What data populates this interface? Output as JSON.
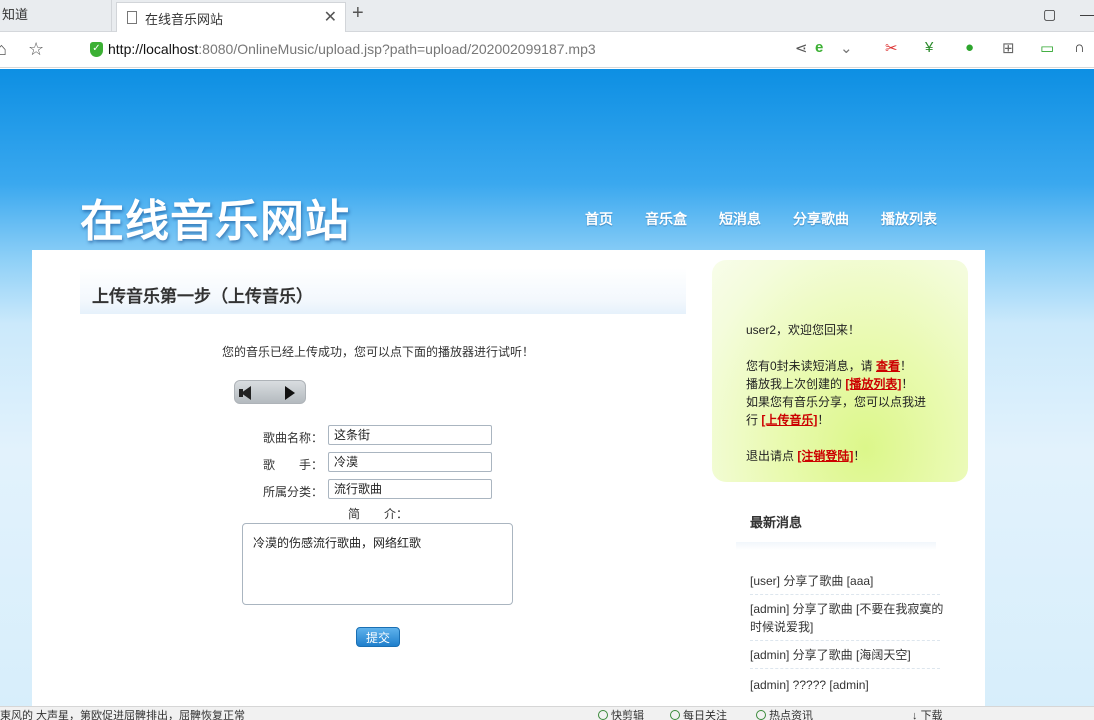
{
  "browser": {
    "left_tab_label": "知道",
    "active_tab_title": "在线音乐网站",
    "url_host": "http://localhost",
    "url_rest": ":8080/OnlineMusic/upload.jsp?path=upload/202002099187.mp3"
  },
  "site": {
    "logo": "在线音乐网站",
    "nav": [
      "首页",
      "音乐盒",
      "短消息",
      "分享歌曲",
      "播放列表"
    ]
  },
  "main": {
    "title": "上传音乐第一步（上传音乐）",
    "success_message": "您的音乐已经上传成功，您可以点下面的播放器进行试听！",
    "form": {
      "song_name_label": "歌曲名称：",
      "song_name_value": "这条街",
      "singer_label": "歌　　手：",
      "singer_value": "冷漠",
      "category_label": "所属分类：",
      "category_value": "流行歌曲",
      "intro_label": "简　　介：",
      "intro_value": "冷漠的伤感流行歌曲，网络红歌",
      "submit_label": "提交"
    }
  },
  "sidebar": {
    "welcome": "user2，欢迎您回来！",
    "unread_prefix": "您有0封未读短消息，请",
    "unread_link": "查看",
    "unread_suffix": "！",
    "playlist_prefix": "播放我上次创建的",
    "playlist_link": "[播放列表]",
    "playlist_suffix": "！",
    "share_line1": "如果您有音乐分享，您可以点我进",
    "share_prefix": "行",
    "share_link": "[上传音乐]",
    "share_suffix": "！",
    "logout_prefix": "退出请点",
    "logout_link": "[注销登陆]",
    "logout_suffix": "！",
    "news_title": "最新消息",
    "news": [
      "[user] 分享了歌曲 [aaa]",
      "[admin]  分享了歌曲  [不要在我寂寞的时候说爱我]",
      "[admin] 分享了歌曲 [海阔天空]",
      "[admin] ????? [admin]"
    ]
  },
  "statusbar": {
    "message": "東风的 大声星，第欧促进屈髀排出，屈髀恢复正常",
    "items": [
      "快剪辑",
      "每日关注",
      "热点资讯",
      "下载"
    ]
  }
}
